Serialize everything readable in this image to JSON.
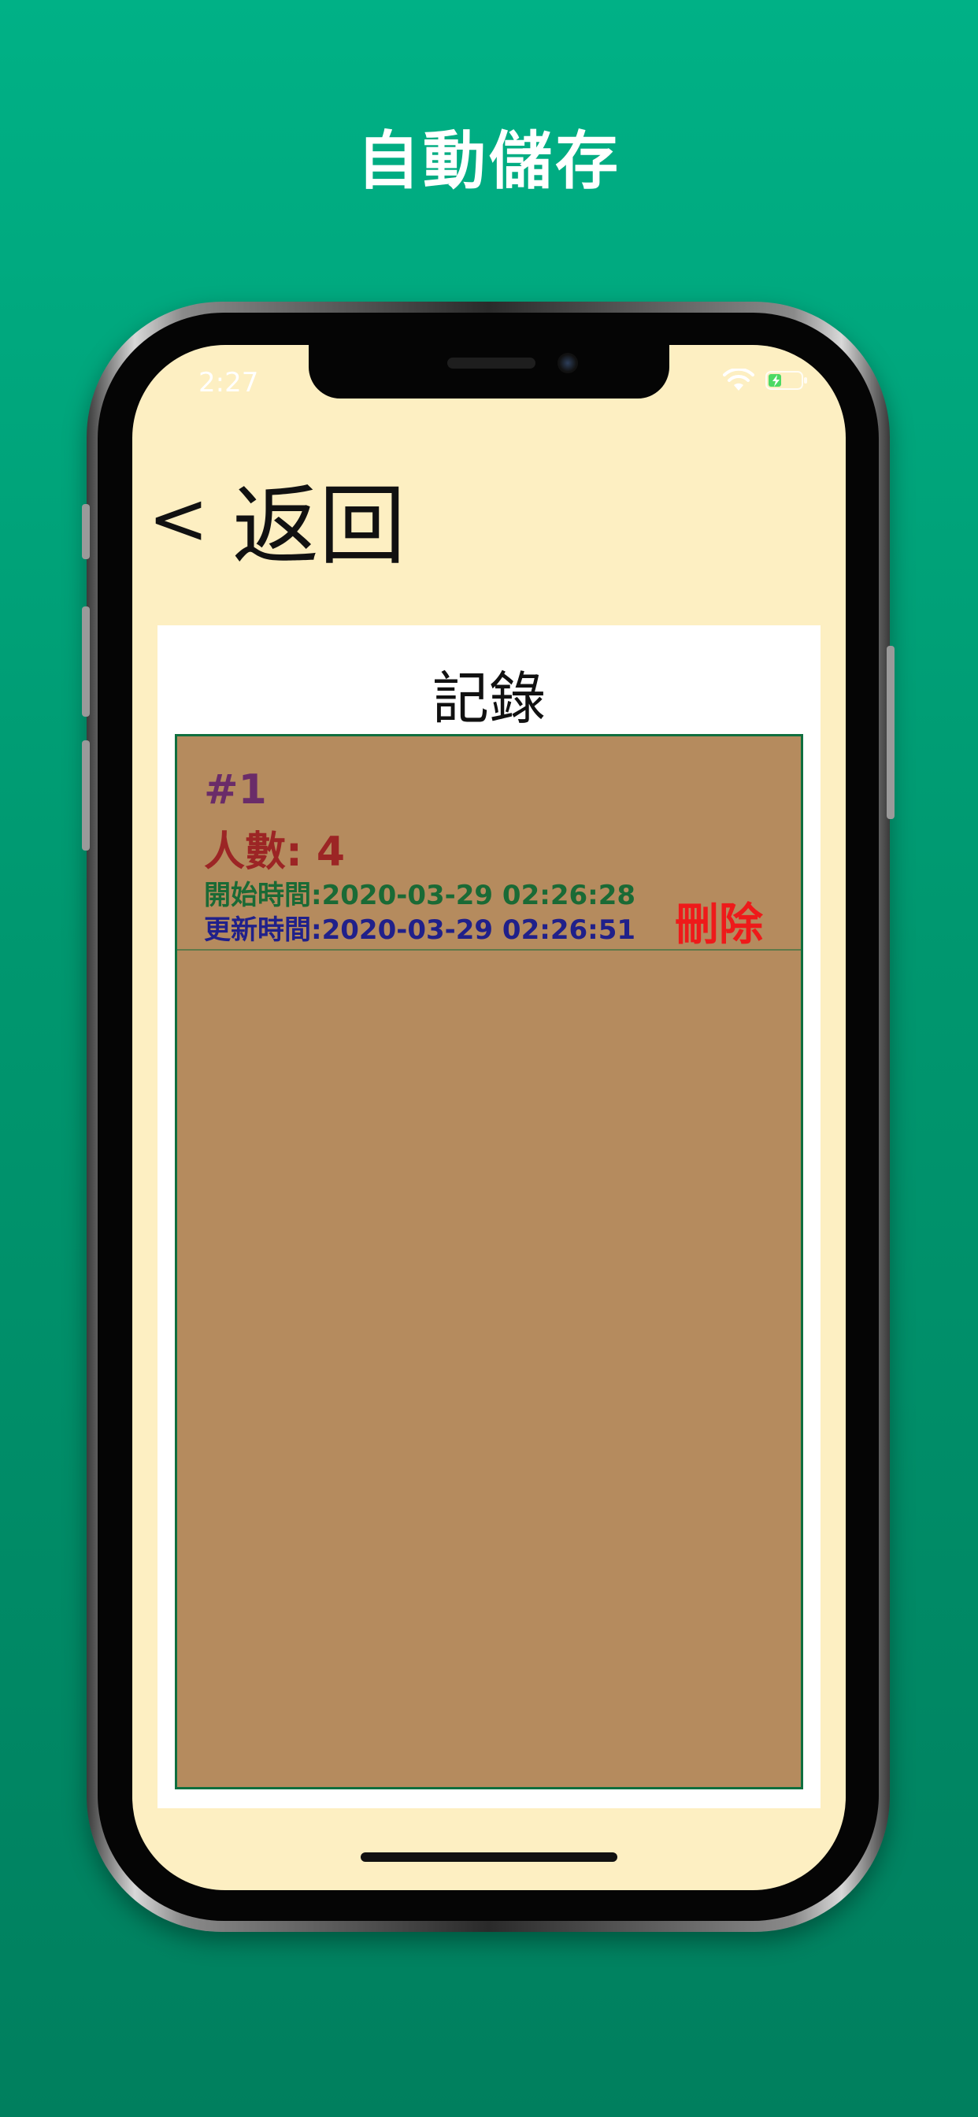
{
  "headline": "自動儲存",
  "status_bar": {
    "time": "2:27",
    "wifi_icon": "wifi-icon",
    "battery_icon": "battery-charging-icon",
    "battery_color": "#4cd964"
  },
  "nav": {
    "back_label": "返回",
    "back_icon": "<"
  },
  "panel": {
    "title": "記錄",
    "records": [
      {
        "number": "#1",
        "people": "人數: 4",
        "start_time": "開始時間:2020-03-29 02:26:28",
        "update_time": "更新時間:2020-03-29 02:26:51",
        "delete_label": "刪除"
      }
    ]
  },
  "colors": {
    "background": "#00a87f",
    "screen_bg": "#fdefc2",
    "list_bg": "#b58b5e",
    "number_color": "#6a2c69",
    "people_color": "#9c2525",
    "start_color": "#1a6a35",
    "update_color": "#20208a",
    "delete_color": "#ee1a1a"
  }
}
